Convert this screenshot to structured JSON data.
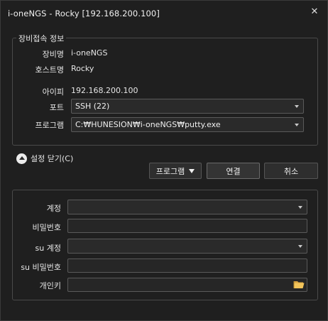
{
  "window": {
    "title": "i-oneNGS - Rocky [192.168.200.100]",
    "close_glyph": "✕"
  },
  "device_info": {
    "legend": "장비접속 정보",
    "name_label": "장비명",
    "name_value": "i-oneNGS",
    "host_label": "호스트명",
    "host_value": "Rocky",
    "ip_label": "아이피",
    "ip_value": "192.168.200.100",
    "port_label": "포트",
    "port_value": "SSH (22)",
    "program_label": "프로그램",
    "program_value": "C:₩HUNESION₩i-oneNGS₩putty.exe"
  },
  "settings_toggle": {
    "label": "설정 닫기(C)",
    "icon": "chevron-up-circle-icon"
  },
  "actions": {
    "program_menu": "프로그램",
    "connect": "연결",
    "cancel": "취소"
  },
  "account": {
    "account_label": "계정",
    "account_value": "",
    "password_label": "비밀번호",
    "password_value": "",
    "su_account_label": "su 계정",
    "su_account_value": "",
    "su_password_label": "su 비밀번호",
    "su_password_value": "",
    "private_key_label": "개인키",
    "private_key_value": "",
    "private_key_icon": "folder-open-icon"
  },
  "colors": {
    "background": "#1f1f1f",
    "border": "#4a4a4a",
    "text": "#e6e6e6",
    "field": "#262626"
  }
}
